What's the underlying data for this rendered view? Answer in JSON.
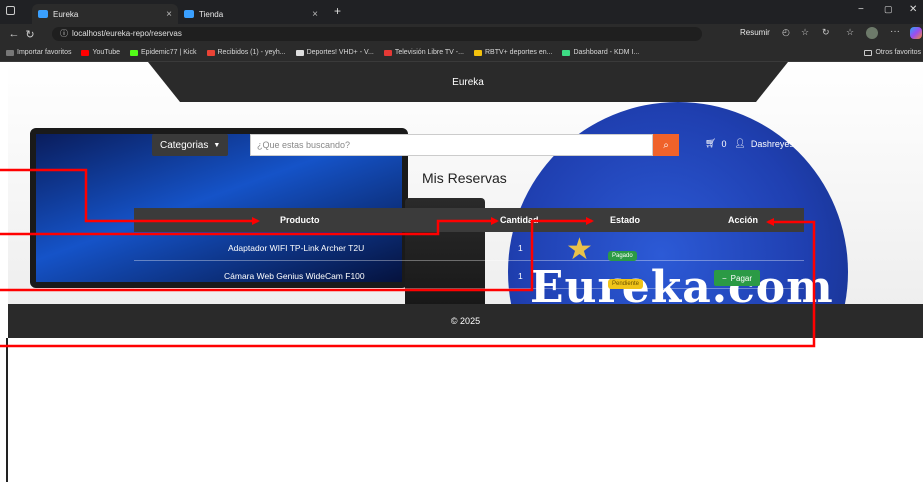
{
  "browser": {
    "tabs": [
      {
        "label": "Eureka",
        "close": "×"
      },
      {
        "label": "Tienda",
        "close": "×"
      }
    ],
    "new_tab": "+",
    "url": "localhost/eureka-repo/reservas",
    "resumir": "Resumir",
    "bookmarks": [
      {
        "label": "Importar favoritos",
        "color": "#777777"
      },
      {
        "label": "YouTube",
        "color": "#ff0000"
      },
      {
        "label": "Epidemic77 | Kick",
        "color": "#53fc18"
      },
      {
        "label": "Recibidos (1) - yeyh...",
        "color": "#ea4335"
      },
      {
        "label": "Deportes! VHD+ - V...",
        "color": "#dddddd"
      },
      {
        "label": "Televisión Libre TV -...",
        "color": "#e53935"
      },
      {
        "label": "RBTV+ deportes en...",
        "color": "#f4c20d"
      },
      {
        "label": "Dashboard - KDM I...",
        "color": "#3ddc84"
      }
    ],
    "other_favorites": "Otros favoritos"
  },
  "site": {
    "brand": "Eureka",
    "categories_label": "Categorias",
    "search_placeholder": "¿Que estas buscando?",
    "cart_count": "0",
    "username": "Dashreyes",
    "page_title": "Mis Reservas",
    "table": {
      "headers": [
        "Producto",
        "Cantidad",
        "Estado",
        "Acción"
      ],
      "rows": [
        {
          "product": "Adaptador WIFI TP-Link Archer T2U",
          "qty": "1",
          "status": "Pagado",
          "status_color": "#2b9a45",
          "action": ""
        },
        {
          "product": "Cámara Web Genius WideCam F100",
          "qty": "1",
          "status": "Pendiente",
          "status_color": "#f0c419",
          "action": "Pagar"
        }
      ]
    },
    "background_text": "Eureka.com",
    "footer": "© 2025"
  },
  "annotation_color": "#ff0000"
}
